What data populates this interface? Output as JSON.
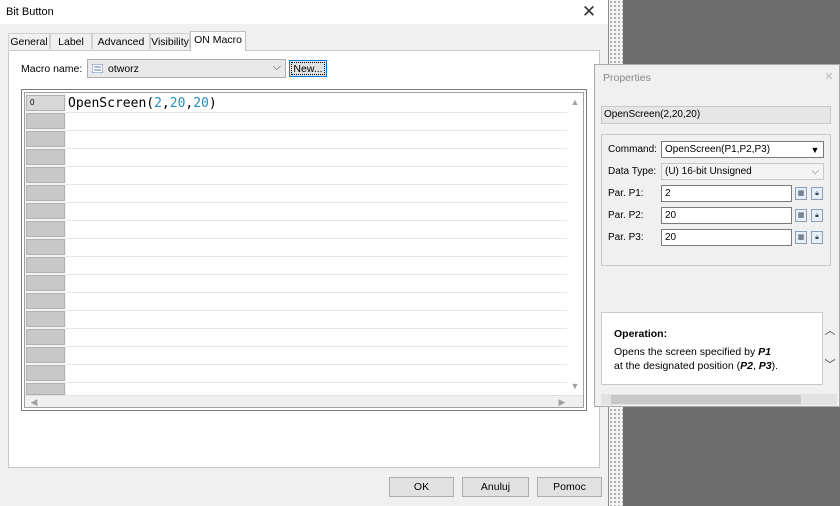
{
  "dialog": {
    "title": "Bit Button",
    "close_glyph": "✕"
  },
  "tabs": [
    {
      "label": "General"
    },
    {
      "label": "Label"
    },
    {
      "label": "Advanced"
    },
    {
      "label": "Visibility"
    },
    {
      "label": "ON Macro"
    }
  ],
  "active_tab": "ON Macro",
  "macro": {
    "name_label": "Macro name:",
    "selected": "otworz",
    "new_button": "New..."
  },
  "editor": {
    "line_number": "0",
    "code_fn": "OpenScreen(",
    "code_a1": "2",
    "code_sep1": ",",
    "code_a2": "20",
    "code_sep2": ",",
    "code_a3": "20",
    "code_end": ")"
  },
  "buttons": {
    "ok": "OK",
    "cancel": "Anuluj",
    "help": "Pomoc"
  },
  "properties": {
    "title": "Properties",
    "expression": "OpenScreen(2,20,20)",
    "command_label": "Command:",
    "command_value": "OpenScreen(P1,P2,P3)",
    "data_type_label": "Data Type:",
    "data_type_value": "(U) 16-bit Unsigned",
    "p1_label": "Par. P1:",
    "p1_value": "2",
    "p2_label": "Par. P2:",
    "p2_value": "20",
    "p3_label": "Par. P3:",
    "p3_value": "20",
    "operation_title": "Operation:",
    "operation_text_1": "Opens the screen specified by ",
    "operation_p1": "P1",
    "operation_text_2": "at the designated position (",
    "operation_p2": "P2",
    "operation_comma": ", ",
    "operation_p3": "P3",
    "operation_end": ")."
  }
}
